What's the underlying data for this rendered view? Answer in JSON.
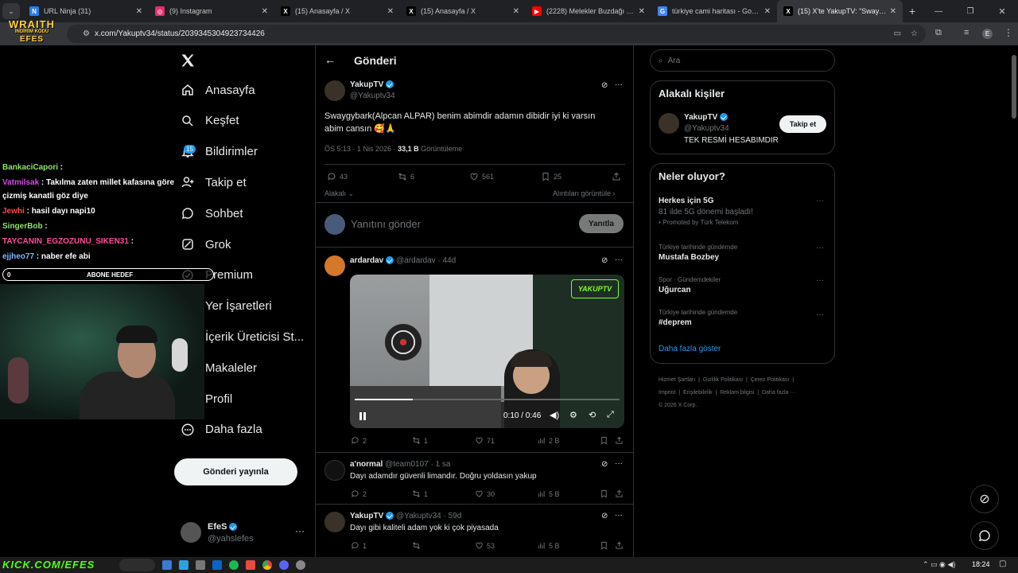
{
  "browser": {
    "tabs": [
      {
        "title": "URL Ninja (31)",
        "color": "#2b7de9",
        "glyph": "N"
      },
      {
        "title": "(9) Instagram",
        "color": "#e1306c",
        "glyph": "◎"
      },
      {
        "title": "(15) Anasayfa / X",
        "color": "#000000",
        "glyph": "X"
      },
      {
        "title": "(15) Anasayfa / X",
        "color": "#000000",
        "glyph": "X"
      },
      {
        "title": "(2228) Melekler Buzdağı | Tanrı",
        "color": "#ff0000",
        "glyph": "▶"
      },
      {
        "title": "türkiye cami haritası - Google'd",
        "color": "#4285f4",
        "glyph": "G"
      },
      {
        "title": "(15) X'te YakupTV: \"Swaygy",
        "color": "#000000",
        "glyph": "X"
      }
    ],
    "url": "x.com/Yakuptv34/status/2039345304923734426"
  },
  "overlay": {
    "logo_top": "WRAITH",
    "logo_sub": "İNDİRİM KODU",
    "logo_code": "EFES",
    "chat": [
      {
        "user": "BankaciCapori",
        "user_color": "#8fe36b",
        "msg": ""
      },
      {
        "user": "Vatmilsak",
        "user_color": "#d64ce8",
        "msg": "Takılma zaten millet kafasına göre"
      },
      {
        "user": "",
        "user_color": "#ffffff",
        "msg": "çizmiş kanatli göz diye"
      },
      {
        "user": "Jewhi",
        "user_color": "#ff4d4d",
        "msg": "hasil dayı napi10"
      },
      {
        "user": "SingerBob",
        "user_color": "#8fe36b",
        "msg": ""
      },
      {
        "user": "TAYCANIN_EGZOZUNU_SIKEN31",
        "user_color": "#ff4d9a",
        "msg": ""
      },
      {
        "user": "ejjheo77",
        "user_color": "#7fb7ff",
        "msg": "naber efe abi"
      }
    ],
    "goal_count": "0",
    "goal_label": "ABONE HEDEF",
    "footer": "KICK.COM/EFES"
  },
  "nav": {
    "items": [
      "Anasayfa",
      "Keşfet",
      "Bildirimler",
      "Takip et",
      "Sohbet",
      "Grok",
      "Premium",
      "Yer İşaretleri",
      "İçerik Üreticisi St...",
      "Makaleler",
      "Profil",
      "Daha fazla"
    ],
    "badge": "15",
    "post_button": "Gönderi yayınla",
    "me_name": "EfeS",
    "me_handle": "@yahslefes"
  },
  "main": {
    "header": "Gönderi",
    "post": {
      "name": "YakupTV",
      "handle": "@Yakuptv34",
      "text_line1": "Swaygybark(Alpcan ALPAR) benim abimdir adamın dibidir iyi ki varsın",
      "text_line2": "abim cansın 🥰🙏",
      "time": "ÖS 5:13 · 1 Nis 2026 ·",
      "views": "33,1 B",
      "views_label": "Görüntüleme",
      "replies": "43",
      "reposts": "6",
      "likes": "561",
      "bookmarks": "25",
      "relevant": "Alakalı",
      "quotes": "Alıntıları görüntüle"
    },
    "reply_placeholder": "Yanıtını gönder",
    "reply_button": "Yanıtla",
    "replies": [
      {
        "name": "ardardav",
        "handle": "@ardardav · 44d",
        "text": "",
        "c": "2",
        "r": "1",
        "l": "71",
        "v": "2 B",
        "video_time": "0:10 / 0:46",
        "video_progress": 0.22
      },
      {
        "name": "a'normal",
        "handle": "@team0107 · 1 sa",
        "text": "Dayı adamdır güvenli limandır. Doğru yoldasın yakup",
        "c": "2",
        "r": "1",
        "l": "30",
        "v": "5 B"
      },
      {
        "name": "YakupTV",
        "handle": "@Yakuptv34 · 59d",
        "text": "Dayı gibi kaliteli adam yok ki çok piyasada",
        "c": "1",
        "r": "",
        "l": "53",
        "v": "5 B"
      }
    ]
  },
  "right": {
    "search_placeholder": "Ara",
    "who_title": "Alakalı kişiler",
    "who": {
      "name": "YakupTV",
      "handle": "@Yakuptv34",
      "bio": "TEK RESMİ HESABIMDIR",
      "button": "Takip et"
    },
    "trends_title": "Neler oluyor?",
    "trends": [
      {
        "meta": "",
        "title": "Herkes için 5G",
        "sub": "81 ilde 5G dönemi başladı!",
        "promo": "Promoted by Türk Telekom"
      },
      {
        "meta": "Türkiye tarihinde gündemde",
        "title": "Mustafa Bozbey"
      },
      {
        "meta": "Spor · Gündemdekiler",
        "title": "Uğurcan"
      },
      {
        "meta": "Türkiye tarihinde gündemde",
        "title": "#deprem"
      }
    ],
    "more": "Daha fazla göster",
    "footer1": [
      "Hizmet Şartları",
      "Gizlilik Politikası",
      "Çerez Politikası"
    ],
    "footer2": [
      "Imprint",
      "Erişilebilirlik",
      "Reklam bilgisi",
      "Daha fazla ···"
    ],
    "copyright": "© 2026 X Corp."
  },
  "taskbar": {
    "time": "18:24"
  }
}
